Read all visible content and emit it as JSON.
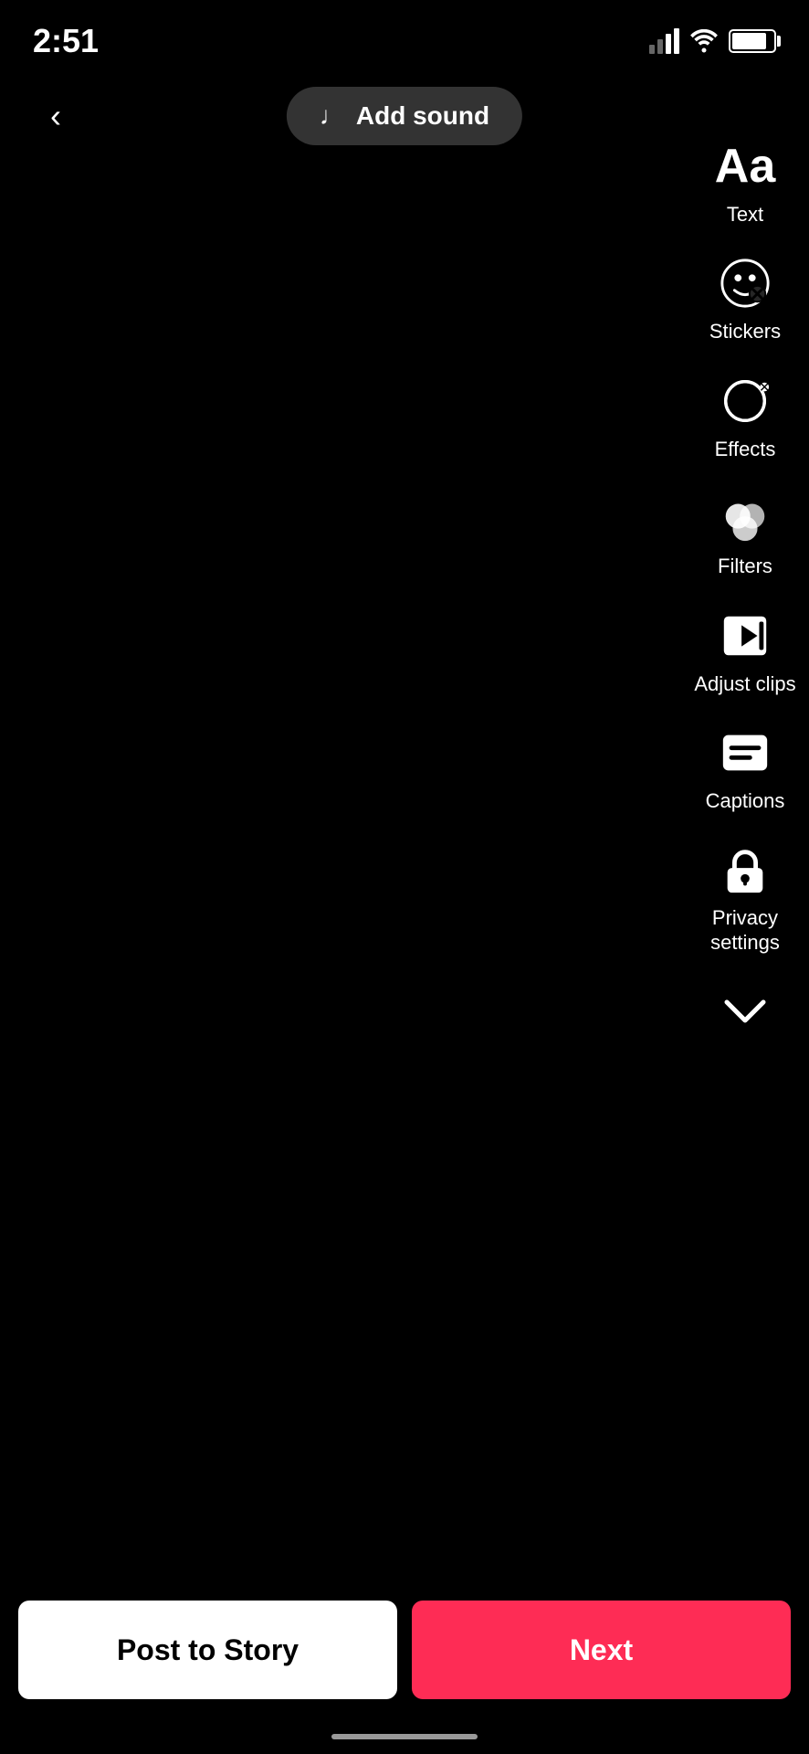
{
  "statusBar": {
    "time": "2:51",
    "battery": "85"
  },
  "toolbar": {
    "addSound": "Add sound",
    "back": "<"
  },
  "rightMenu": {
    "text": {
      "label": "Text",
      "icon": "Aa"
    },
    "stickers": {
      "label": "Stickers"
    },
    "effects": {
      "label": "Effects"
    },
    "filters": {
      "label": "Filters"
    },
    "adjustClips": {
      "label": "Adjust clips"
    },
    "captions": {
      "label": "Captions"
    },
    "privacySettings": {
      "label": "Privacy\nsettings"
    }
  },
  "bottomButtons": {
    "postStory": "Post to Story",
    "next": "Next"
  }
}
